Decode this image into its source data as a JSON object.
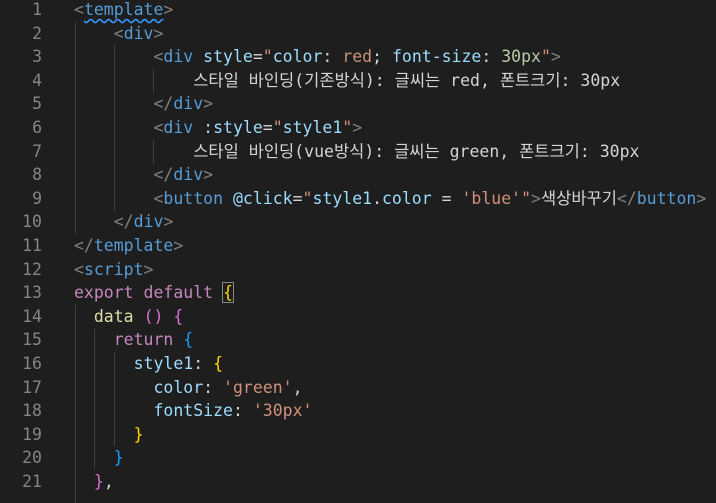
{
  "editor": {
    "line_numbers": [
      "1",
      "2",
      "3",
      "4",
      "5",
      "6",
      "7",
      "8",
      "9",
      "10",
      "11",
      "12",
      "13",
      "14",
      "15",
      "16",
      "17",
      "18",
      "19",
      "20",
      "21"
    ],
    "lines": [
      [
        {
          "t": "<",
          "c": "bracket"
        },
        {
          "t": "template",
          "c": "tag",
          "sq": true
        },
        {
          "t": ">",
          "c": "bracket"
        }
      ],
      [
        {
          "t": "    "
        },
        {
          "t": "<",
          "c": "bracket"
        },
        {
          "t": "div",
          "c": "tag"
        },
        {
          "t": ">",
          "c": "bracket"
        }
      ],
      [
        {
          "t": "        "
        },
        {
          "t": "<",
          "c": "bracket"
        },
        {
          "t": "div",
          "c": "tag"
        },
        {
          "t": " "
        },
        {
          "t": "style",
          "c": "attr"
        },
        {
          "t": "=",
          "c": "text"
        },
        {
          "t": "\"",
          "c": "str"
        },
        {
          "t": "color",
          "c": "attr"
        },
        {
          "t": ": ",
          "c": "text"
        },
        {
          "t": "red",
          "c": "str"
        },
        {
          "t": "; ",
          "c": "text"
        },
        {
          "t": "font-size",
          "c": "attr"
        },
        {
          "t": ": ",
          "c": "text"
        },
        {
          "t": "30px",
          "c": "num"
        },
        {
          "t": "\"",
          "c": "str"
        },
        {
          "t": ">",
          "c": "bracket"
        }
      ],
      [
        {
          "t": "            스타일 바인딩(기존방식): 글씨는 red, 폰트크기: 30px",
          "c": "text"
        }
      ],
      [
        {
          "t": "        "
        },
        {
          "t": "</",
          "c": "bracket"
        },
        {
          "t": "div",
          "c": "tag"
        },
        {
          "t": ">",
          "c": "bracket"
        }
      ],
      [
        {
          "t": "        "
        },
        {
          "t": "<",
          "c": "bracket"
        },
        {
          "t": "div",
          "c": "tag"
        },
        {
          "t": " "
        },
        {
          "t": ":style",
          "c": "attr"
        },
        {
          "t": "=",
          "c": "text"
        },
        {
          "t": "\"",
          "c": "str"
        },
        {
          "t": "style1",
          "c": "prop"
        },
        {
          "t": "\"",
          "c": "str"
        },
        {
          "t": ">",
          "c": "bracket"
        }
      ],
      [
        {
          "t": "            스타일 바인딩(vue방식): 글씨는 green, 폰트크기: 30px",
          "c": "text"
        }
      ],
      [
        {
          "t": "        "
        },
        {
          "t": "</",
          "c": "bracket"
        },
        {
          "t": "div",
          "c": "tag"
        },
        {
          "t": ">",
          "c": "bracket"
        }
      ],
      [
        {
          "t": "        "
        },
        {
          "t": "<",
          "c": "bracket"
        },
        {
          "t": "button",
          "c": "tag"
        },
        {
          "t": " "
        },
        {
          "t": "@click",
          "c": "attr"
        },
        {
          "t": "=",
          "c": "text"
        },
        {
          "t": "\"",
          "c": "str"
        },
        {
          "t": "style1",
          "c": "prop"
        },
        {
          "t": ".",
          "c": "text"
        },
        {
          "t": "color",
          "c": "prop"
        },
        {
          "t": " = ",
          "c": "text"
        },
        {
          "t": "'blue'",
          "c": "str"
        },
        {
          "t": "\"",
          "c": "str"
        },
        {
          "t": ">",
          "c": "bracket"
        },
        {
          "t": "색상바꾸기",
          "c": "text"
        },
        {
          "t": "</",
          "c": "bracket"
        },
        {
          "t": "button",
          "c": "tag"
        },
        {
          "t": ">",
          "c": "bracket"
        }
      ],
      [
        {
          "t": "    "
        },
        {
          "t": "</",
          "c": "bracket"
        },
        {
          "t": "div",
          "c": "tag"
        },
        {
          "t": ">",
          "c": "bracket"
        }
      ],
      [
        {
          "t": "</",
          "c": "bracket"
        },
        {
          "t": "template",
          "c": "tag"
        },
        {
          "t": ">",
          "c": "bracket"
        }
      ],
      [
        {
          "t": "<",
          "c": "bracket"
        },
        {
          "t": "script",
          "c": "tag"
        },
        {
          "t": ">",
          "c": "bracket"
        }
      ],
      [
        {
          "t": "export",
          "c": "kw"
        },
        {
          "t": " "
        },
        {
          "t": "default",
          "c": "kw"
        },
        {
          "t": " "
        },
        {
          "t": "{",
          "c": "brace-y",
          "m": true
        }
      ],
      [
        {
          "t": "  "
        },
        {
          "t": "data",
          "c": "fn"
        },
        {
          "t": " "
        },
        {
          "t": "()",
          "c": "brace-p"
        },
        {
          "t": " "
        },
        {
          "t": "{",
          "c": "brace-p"
        }
      ],
      [
        {
          "t": "    "
        },
        {
          "t": "return",
          "c": "ctl"
        },
        {
          "t": " "
        },
        {
          "t": "{",
          "c": "brace-b"
        }
      ],
      [
        {
          "t": "      "
        },
        {
          "t": "style1",
          "c": "prop"
        },
        {
          "t": ": ",
          "c": "text"
        },
        {
          "t": "{",
          "c": "brace-y"
        }
      ],
      [
        {
          "t": "        "
        },
        {
          "t": "color",
          "c": "prop"
        },
        {
          "t": ": ",
          "c": "text"
        },
        {
          "t": "'green'",
          "c": "str"
        },
        {
          "t": ",",
          "c": "text"
        }
      ],
      [
        {
          "t": "        "
        },
        {
          "t": "fontSize",
          "c": "prop"
        },
        {
          "t": ": ",
          "c": "text"
        },
        {
          "t": "'30px'",
          "c": "str"
        }
      ],
      [
        {
          "t": "      "
        },
        {
          "t": "}",
          "c": "brace-y"
        }
      ],
      [
        {
          "t": "    "
        },
        {
          "t": "}",
          "c": "brace-b"
        }
      ],
      [
        {
          "t": "  "
        },
        {
          "t": "}",
          "c": "brace-p"
        },
        {
          "t": ",",
          "c": "text"
        }
      ]
    ]
  }
}
